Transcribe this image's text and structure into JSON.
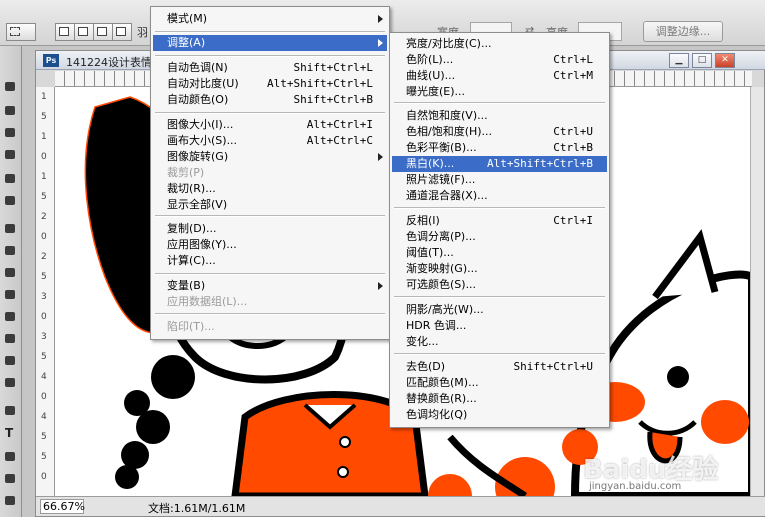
{
  "options_bar": {
    "feather_label": "羽",
    "width_label": "宽度",
    "height_label": "高度",
    "refine_edge_label": "调整边缘..."
  },
  "document": {
    "title": "141224设计表情",
    "zoom": "66.67%",
    "doc_info": "文档:1.61M/1.61M",
    "ruler_v_marks": [
      "1",
      "5",
      "1",
      "0",
      "1",
      "5",
      "2",
      "0",
      "2",
      "5",
      "3",
      "0",
      "3",
      "5",
      "4",
      "0",
      "4",
      "5",
      "5",
      "0"
    ]
  },
  "watermark": {
    "text": "Baidu经验",
    "url": "jingyan.baidu.com"
  },
  "image_menu": {
    "items": [
      {
        "label": "模式(M)",
        "shortcut": "",
        "submenu": true
      },
      {
        "label": "调整(A)",
        "shortcut": "",
        "submenu": true,
        "highlighted": true
      },
      {
        "label": "自动色调(N)",
        "shortcut": "Shift+Ctrl+L"
      },
      {
        "label": "自动对比度(U)",
        "shortcut": "Alt+Shift+Ctrl+L"
      },
      {
        "label": "自动颜色(O)",
        "shortcut": "Shift+Ctrl+B"
      },
      {
        "label": "图像大小(I)...",
        "shortcut": "Alt+Ctrl+I"
      },
      {
        "label": "画布大小(S)...",
        "shortcut": "Alt+Ctrl+C"
      },
      {
        "label": "图像旋转(G)",
        "shortcut": "",
        "submenu": true
      },
      {
        "label": "裁剪(P)",
        "shortcut": "",
        "disabled": true
      },
      {
        "label": "裁切(R)...",
        "shortcut": ""
      },
      {
        "label": "显示全部(V)",
        "shortcut": ""
      },
      {
        "label": "复制(D)...",
        "shortcut": ""
      },
      {
        "label": "应用图像(Y)...",
        "shortcut": ""
      },
      {
        "label": "计算(C)...",
        "shortcut": ""
      },
      {
        "label": "变量(B)",
        "shortcut": "",
        "submenu": true
      },
      {
        "label": "应用数据组(L)...",
        "shortcut": "",
        "disabled": true
      },
      {
        "label": "陷印(T)...",
        "shortcut": "",
        "disabled": true
      }
    ]
  },
  "adjust_menu": {
    "items": [
      {
        "label": "亮度/对比度(C)...",
        "shortcut": ""
      },
      {
        "label": "色阶(L)...",
        "shortcut": "Ctrl+L"
      },
      {
        "label": "曲线(U)...",
        "shortcut": "Ctrl+M"
      },
      {
        "label": "曝光度(E)...",
        "shortcut": ""
      },
      {
        "label": "自然饱和度(V)...",
        "shortcut": ""
      },
      {
        "label": "色相/饱和度(H)...",
        "shortcut": "Ctrl+U"
      },
      {
        "label": "色彩平衡(B)...",
        "shortcut": "Ctrl+B"
      },
      {
        "label": "黑白(K)...",
        "shortcut": "Alt+Shift+Ctrl+B",
        "highlighted": true
      },
      {
        "label": "照片滤镜(F)...",
        "shortcut": ""
      },
      {
        "label": "通道混合器(X)...",
        "shortcut": ""
      },
      {
        "label": "反相(I)",
        "shortcut": "Ctrl+I"
      },
      {
        "label": "色调分离(P)...",
        "shortcut": ""
      },
      {
        "label": "阈值(T)...",
        "shortcut": ""
      },
      {
        "label": "渐变映射(G)...",
        "shortcut": ""
      },
      {
        "label": "可选颜色(S)...",
        "shortcut": ""
      },
      {
        "label": "阴影/高光(W)...",
        "shortcut": ""
      },
      {
        "label": "HDR 色调...",
        "shortcut": ""
      },
      {
        "label": "变化...",
        "shortcut": ""
      },
      {
        "label": "去色(D)",
        "shortcut": "Shift+Ctrl+U"
      },
      {
        "label": "匹配颜色(M)...",
        "shortcut": ""
      },
      {
        "label": "替换颜色(R)...",
        "shortcut": ""
      },
      {
        "label": "色调均化(Q)",
        "shortcut": ""
      }
    ]
  },
  "colors": {
    "highlight": "#3b6cc7",
    "artwork_orange": "#ff4a00",
    "artwork_black": "#000000"
  }
}
